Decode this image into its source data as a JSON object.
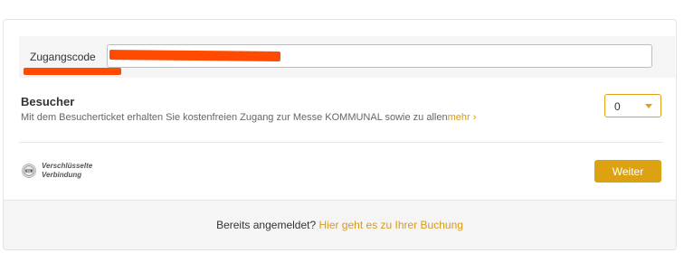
{
  "access_code": {
    "label": "Zugangscode",
    "value": "",
    "redaction_color": "#ff4a00"
  },
  "visitor": {
    "title": "Besucher",
    "description": "Mit dem Besucherticket erhalten Sie kostenfreien Zugang zur Messe KOMMUNAL sowie zu allen",
    "more_link": "mehr ›",
    "quantity": "0"
  },
  "security": {
    "icon": "ssl-seal-icon",
    "line1": "Verschlüsselte",
    "line2": "Verbindung"
  },
  "actions": {
    "next_label": "Weiter"
  },
  "footer": {
    "prompt": "Bereits angemeldet?",
    "link": "Hier geht es zu Ihrer Buchung"
  },
  "colors": {
    "accent": "#dca211",
    "text": "#333333",
    "muted": "#666666",
    "panel_bg": "#f5f5f5"
  }
}
